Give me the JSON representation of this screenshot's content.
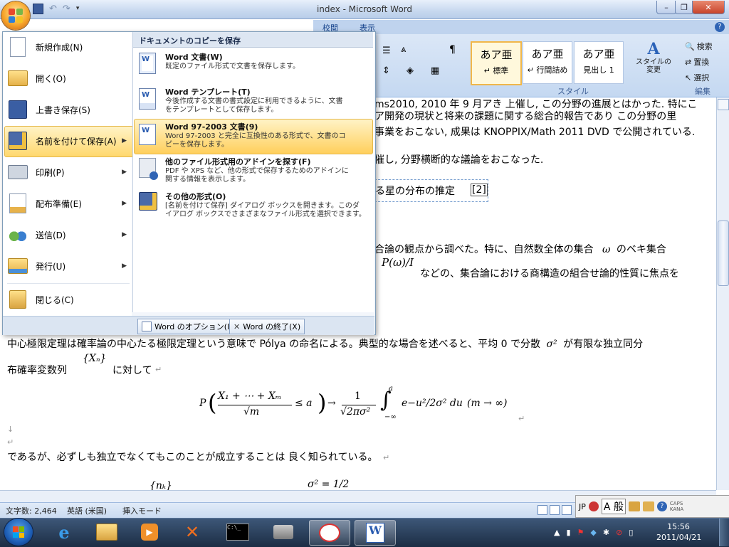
{
  "window": {
    "title": "index - Microsoft Word"
  },
  "ribbon": {
    "tabs": [
      "校閲",
      "表示"
    ],
    "styles": [
      {
        "preview": "あア亜",
        "name": "↵ 標準"
      },
      {
        "preview": "あア亜",
        "name": "↵ 行間詰め"
      },
      {
        "preview": "あア亜",
        "name": "見出し 1"
      }
    ],
    "change_style": "スタイルの\n変更",
    "style_group_label": "スタイル",
    "editing_group_label": "編集",
    "find_label": "検索",
    "replace_label": "置換",
    "select_label": "選択"
  },
  "office_menu": {
    "items": [
      {
        "label": "新規作成(N)",
        "icon": "new-document-icon"
      },
      {
        "label": "開く(O)",
        "icon": "open-folder-icon"
      },
      {
        "label": "上書き保存(S)",
        "icon": "save-disk-icon"
      },
      {
        "label": "名前を付けて保存(A)",
        "icon": "save-as-icon"
      },
      {
        "label": "印刷(P)",
        "icon": "printer-icon"
      },
      {
        "label": "配布準備(E)",
        "icon": "prepare-icon"
      },
      {
        "label": "送信(D)",
        "icon": "send-icon"
      },
      {
        "label": "発行(U)",
        "icon": "publish-icon"
      },
      {
        "label": "閉じる(C)",
        "icon": "close-folder-icon"
      }
    ],
    "save_copy_header": "ドキュメントのコピーを保存",
    "save_options": [
      {
        "title": "Word 文書(W)",
        "desc1": "既定のファイル形式で文書を保存します。",
        "desc2": ""
      },
      {
        "title": "Word テンプレート(T)",
        "desc1": "今後作成する文書の書式設定に利用できるように、文書",
        "desc2": "をテンプレートとして保存します。"
      },
      {
        "title": "Word 97-2003 文書(9)",
        "desc1": "Word 97-2003 と完全に互換性のある形式で、文書のコ",
        "desc2": "ピーを保存します。"
      },
      {
        "title": "他のファイル形式用のアドインを探す(F)",
        "desc1": "PDF や XPS など、他の形式で保存するためのアドインに",
        "desc2": "関する情報を表示します。"
      },
      {
        "title": "その他の形式(O)",
        "desc1": "[名前を付けて保存] ダイアログ ボックスを開きます。このダ",
        "desc2": "イアログ ボックスでさまざまなファイル形式を選択できます。"
      }
    ],
    "word_options": "Word のオプション(I)",
    "exit_word": "Word の終了(X)"
  },
  "document": {
    "line1_tail": "ms2010, 2010 年 9 月アき 上催し, この分野の進展とはかった. 特にこ",
    "line2_tail": "ア開発の現状と将来の課題に関する総合的報告であり この分野の里",
    "line3_tail": "事業をおこない, 成果は KNOPPIX/Math 2011 DVD で公開されている.",
    "line4_tail": "催し, 分野横断的な議論をおこなった.",
    "line5_tail": "る星の分布の推定",
    "ref": "[2]",
    "line6_tail": "合論の観点から調べた。特に、自然数全体の集合",
    "omega": "ω",
    "line6_end": "のベキ集合",
    "p_omega": "P(ω)/I",
    "line7_tail": "などの、集合論における商構造の組合せ論的性質に焦点を",
    "para1a": "中心極限定理は確率論の中心たる極限定理という意味で Pólya の命名による。典型的な場合を述べると、平均 0 で分散",
    "sigma2": "σ²",
    "para1b": "が有限な独立同分",
    "para2a": "布確率変数列",
    "xn": "{Xₙ}",
    "para2b": "に対して",
    "formula_lhs": "P",
    "formula_num": "X₁ + ⋯ + Xₘ",
    "formula_den": "√m",
    "formula_le": "≤ a",
    "formula_arrow": "→",
    "formula_frac_num": "1",
    "formula_frac_den": "√2πσ²",
    "formula_int": "∫",
    "formula_int_up": "a",
    "formula_int_low": "−∞",
    "formula_integrand": "e−u²/2σ² du",
    "formula_limit": "(m → ∞)",
    "para3": "であるが、必ずしも独立でなくてもこのことが成立することは 良く知られている。",
    "nk": "{nₖ}",
    "sigma_half": "σ² = 1/2"
  },
  "status": {
    "word_count": "文字数: 2,464",
    "language": "英語 (米国)",
    "mode": "挿入モード"
  },
  "langbar": {
    "lang": "JP",
    "ime": "A 般",
    "caps": "CAPS",
    "kana": "KANA"
  },
  "taskbar": {
    "time": "15:56",
    "date": "2011/04/21",
    "apps": [
      "internet-explorer-icon",
      "explorer-folder-icon",
      "media-player-icon",
      "xming-icon",
      "command-prompt-icon",
      "printer-app-icon",
      "paint-icon",
      "word-icon"
    ]
  },
  "colors": {
    "accent": "#15428b",
    "menu_highlight": "#ffd86e",
    "taskbar": "#1c2d44"
  }
}
